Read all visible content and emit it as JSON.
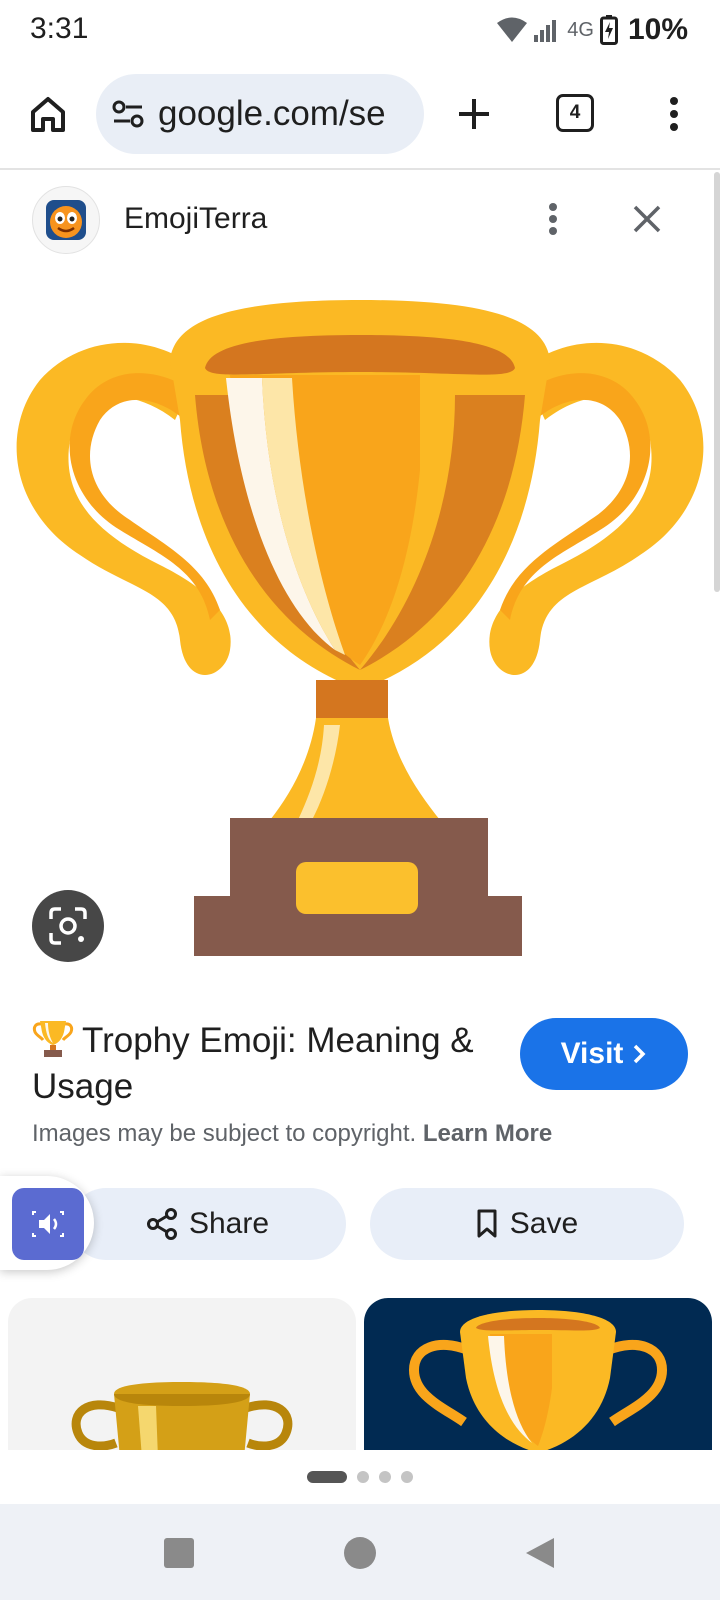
{
  "status_bar": {
    "time": "3:31",
    "network": "4G",
    "battery": "10%"
  },
  "toolbar": {
    "url": "google.com/se",
    "tab_count": "4"
  },
  "source": {
    "name": "EmojiTerra"
  },
  "result": {
    "title": "Trophy Emoji: Meaning & Usage",
    "visit_label": "Visit",
    "copyright_text": "Images may be subject to copyright.",
    "learn_more": "Learn More",
    "share_label": "Share",
    "save_label": "Save"
  },
  "pagination": {
    "pages": 4,
    "active": 1
  },
  "colors": {
    "accent": "#1a73e8",
    "chip_bg": "#e8eef8",
    "tts": "#5b6bd1"
  },
  "icons": [
    "home-icon",
    "site-settings-icon",
    "plus-icon",
    "tab-switcher-icon",
    "more-vert-icon",
    "close-icon",
    "lens-icon",
    "chevron-right-icon",
    "share-icon",
    "bookmark-icon",
    "speaker-icon",
    "trophy-emoji"
  ]
}
